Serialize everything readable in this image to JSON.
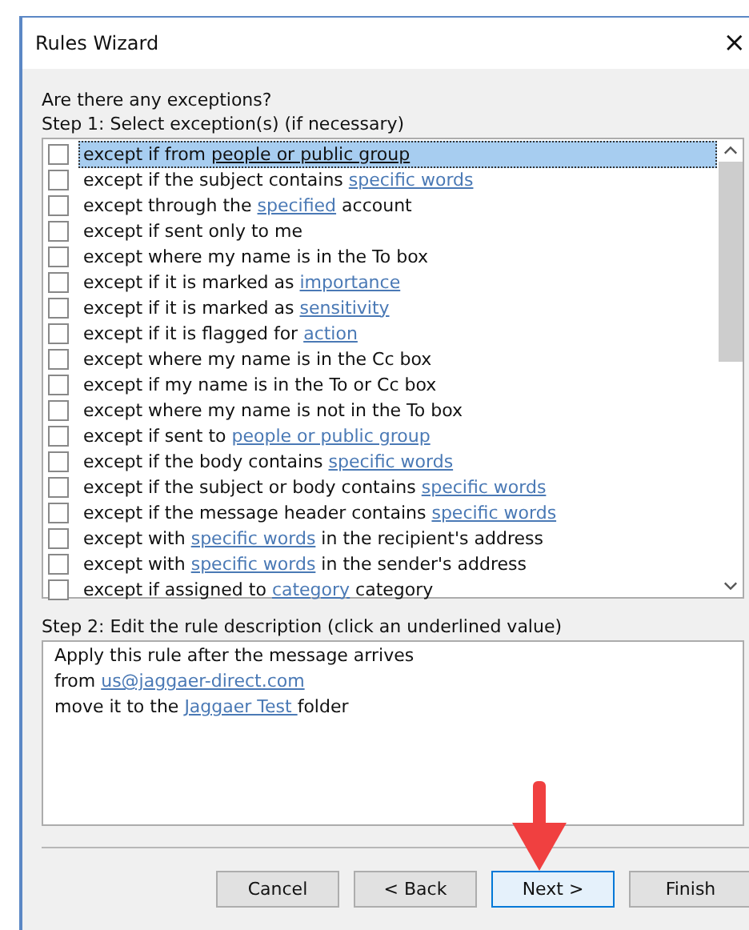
{
  "window": {
    "title": "Rules Wizard",
    "close": "×"
  },
  "question": "Are there any exceptions?",
  "step1": "Step 1: Select exception(s) (if necessary)",
  "exceptions": [
    {
      "checked": false,
      "selected": true,
      "parts": [
        {
          "text": "except if from "
        },
        {
          "text": "people or public group",
          "link": true
        }
      ]
    },
    {
      "checked": false,
      "selected": false,
      "parts": [
        {
          "text": "except if the subject contains "
        },
        {
          "text": "specific words",
          "link": true
        }
      ]
    },
    {
      "checked": false,
      "selected": false,
      "parts": [
        {
          "text": "except through the "
        },
        {
          "text": "specified",
          "link": true
        },
        {
          "text": " account"
        }
      ]
    },
    {
      "checked": false,
      "selected": false,
      "parts": [
        {
          "text": "except if sent only to me"
        }
      ]
    },
    {
      "checked": false,
      "selected": false,
      "parts": [
        {
          "text": "except where my name is in the To box"
        }
      ]
    },
    {
      "checked": false,
      "selected": false,
      "parts": [
        {
          "text": "except if it is marked as "
        },
        {
          "text": "importance",
          "link": true
        }
      ]
    },
    {
      "checked": false,
      "selected": false,
      "parts": [
        {
          "text": "except if it is marked as "
        },
        {
          "text": "sensitivity",
          "link": true
        }
      ]
    },
    {
      "checked": false,
      "selected": false,
      "parts": [
        {
          "text": "except if it is flagged for "
        },
        {
          "text": "action",
          "link": true
        }
      ]
    },
    {
      "checked": false,
      "selected": false,
      "parts": [
        {
          "text": "except where my name is in the Cc box"
        }
      ]
    },
    {
      "checked": false,
      "selected": false,
      "parts": [
        {
          "text": "except if my name is in the To or Cc box"
        }
      ]
    },
    {
      "checked": false,
      "selected": false,
      "parts": [
        {
          "text": "except where my name is not in the To box"
        }
      ]
    },
    {
      "checked": false,
      "selected": false,
      "parts": [
        {
          "text": "except if sent to "
        },
        {
          "text": "people or public group",
          "link": true
        }
      ]
    },
    {
      "checked": false,
      "selected": false,
      "parts": [
        {
          "text": "except if the body contains "
        },
        {
          "text": "specific words",
          "link": true
        }
      ]
    },
    {
      "checked": false,
      "selected": false,
      "parts": [
        {
          "text": "except if the subject or body contains "
        },
        {
          "text": "specific words",
          "link": true
        }
      ]
    },
    {
      "checked": false,
      "selected": false,
      "parts": [
        {
          "text": "except if the message header contains "
        },
        {
          "text": "specific words",
          "link": true
        }
      ]
    },
    {
      "checked": false,
      "selected": false,
      "parts": [
        {
          "text": "except with "
        },
        {
          "text": "specific words",
          "link": true
        },
        {
          "text": " in the recipient's address"
        }
      ]
    },
    {
      "checked": false,
      "selected": false,
      "parts": [
        {
          "text": "except with "
        },
        {
          "text": "specific words",
          "link": true
        },
        {
          "text": " in the sender's address"
        }
      ]
    },
    {
      "checked": false,
      "selected": false,
      "parts": [
        {
          "text": "except if assigned to "
        },
        {
          "text": "category",
          "link": true
        },
        {
          "text": " category"
        }
      ]
    }
  ],
  "step2": "Step 2: Edit the rule description (click an underlined value)",
  "description": [
    [
      {
        "text": "Apply this rule after the message arrives"
      }
    ],
    [
      {
        "text": "from "
      },
      {
        "text": "us@jaggaer-direct.com",
        "link": true
      }
    ],
    [
      {
        "text": "move it to the "
      },
      {
        "text": "Jaggaer Test ",
        "link": true
      },
      {
        "text": " folder"
      }
    ]
  ],
  "buttons": [
    {
      "label": "Cancel",
      "focused": false
    },
    {
      "label": "< Back",
      "focused": false
    },
    {
      "label": "Next >",
      "focused": true
    },
    {
      "label": "Finish",
      "focused": false
    }
  ]
}
